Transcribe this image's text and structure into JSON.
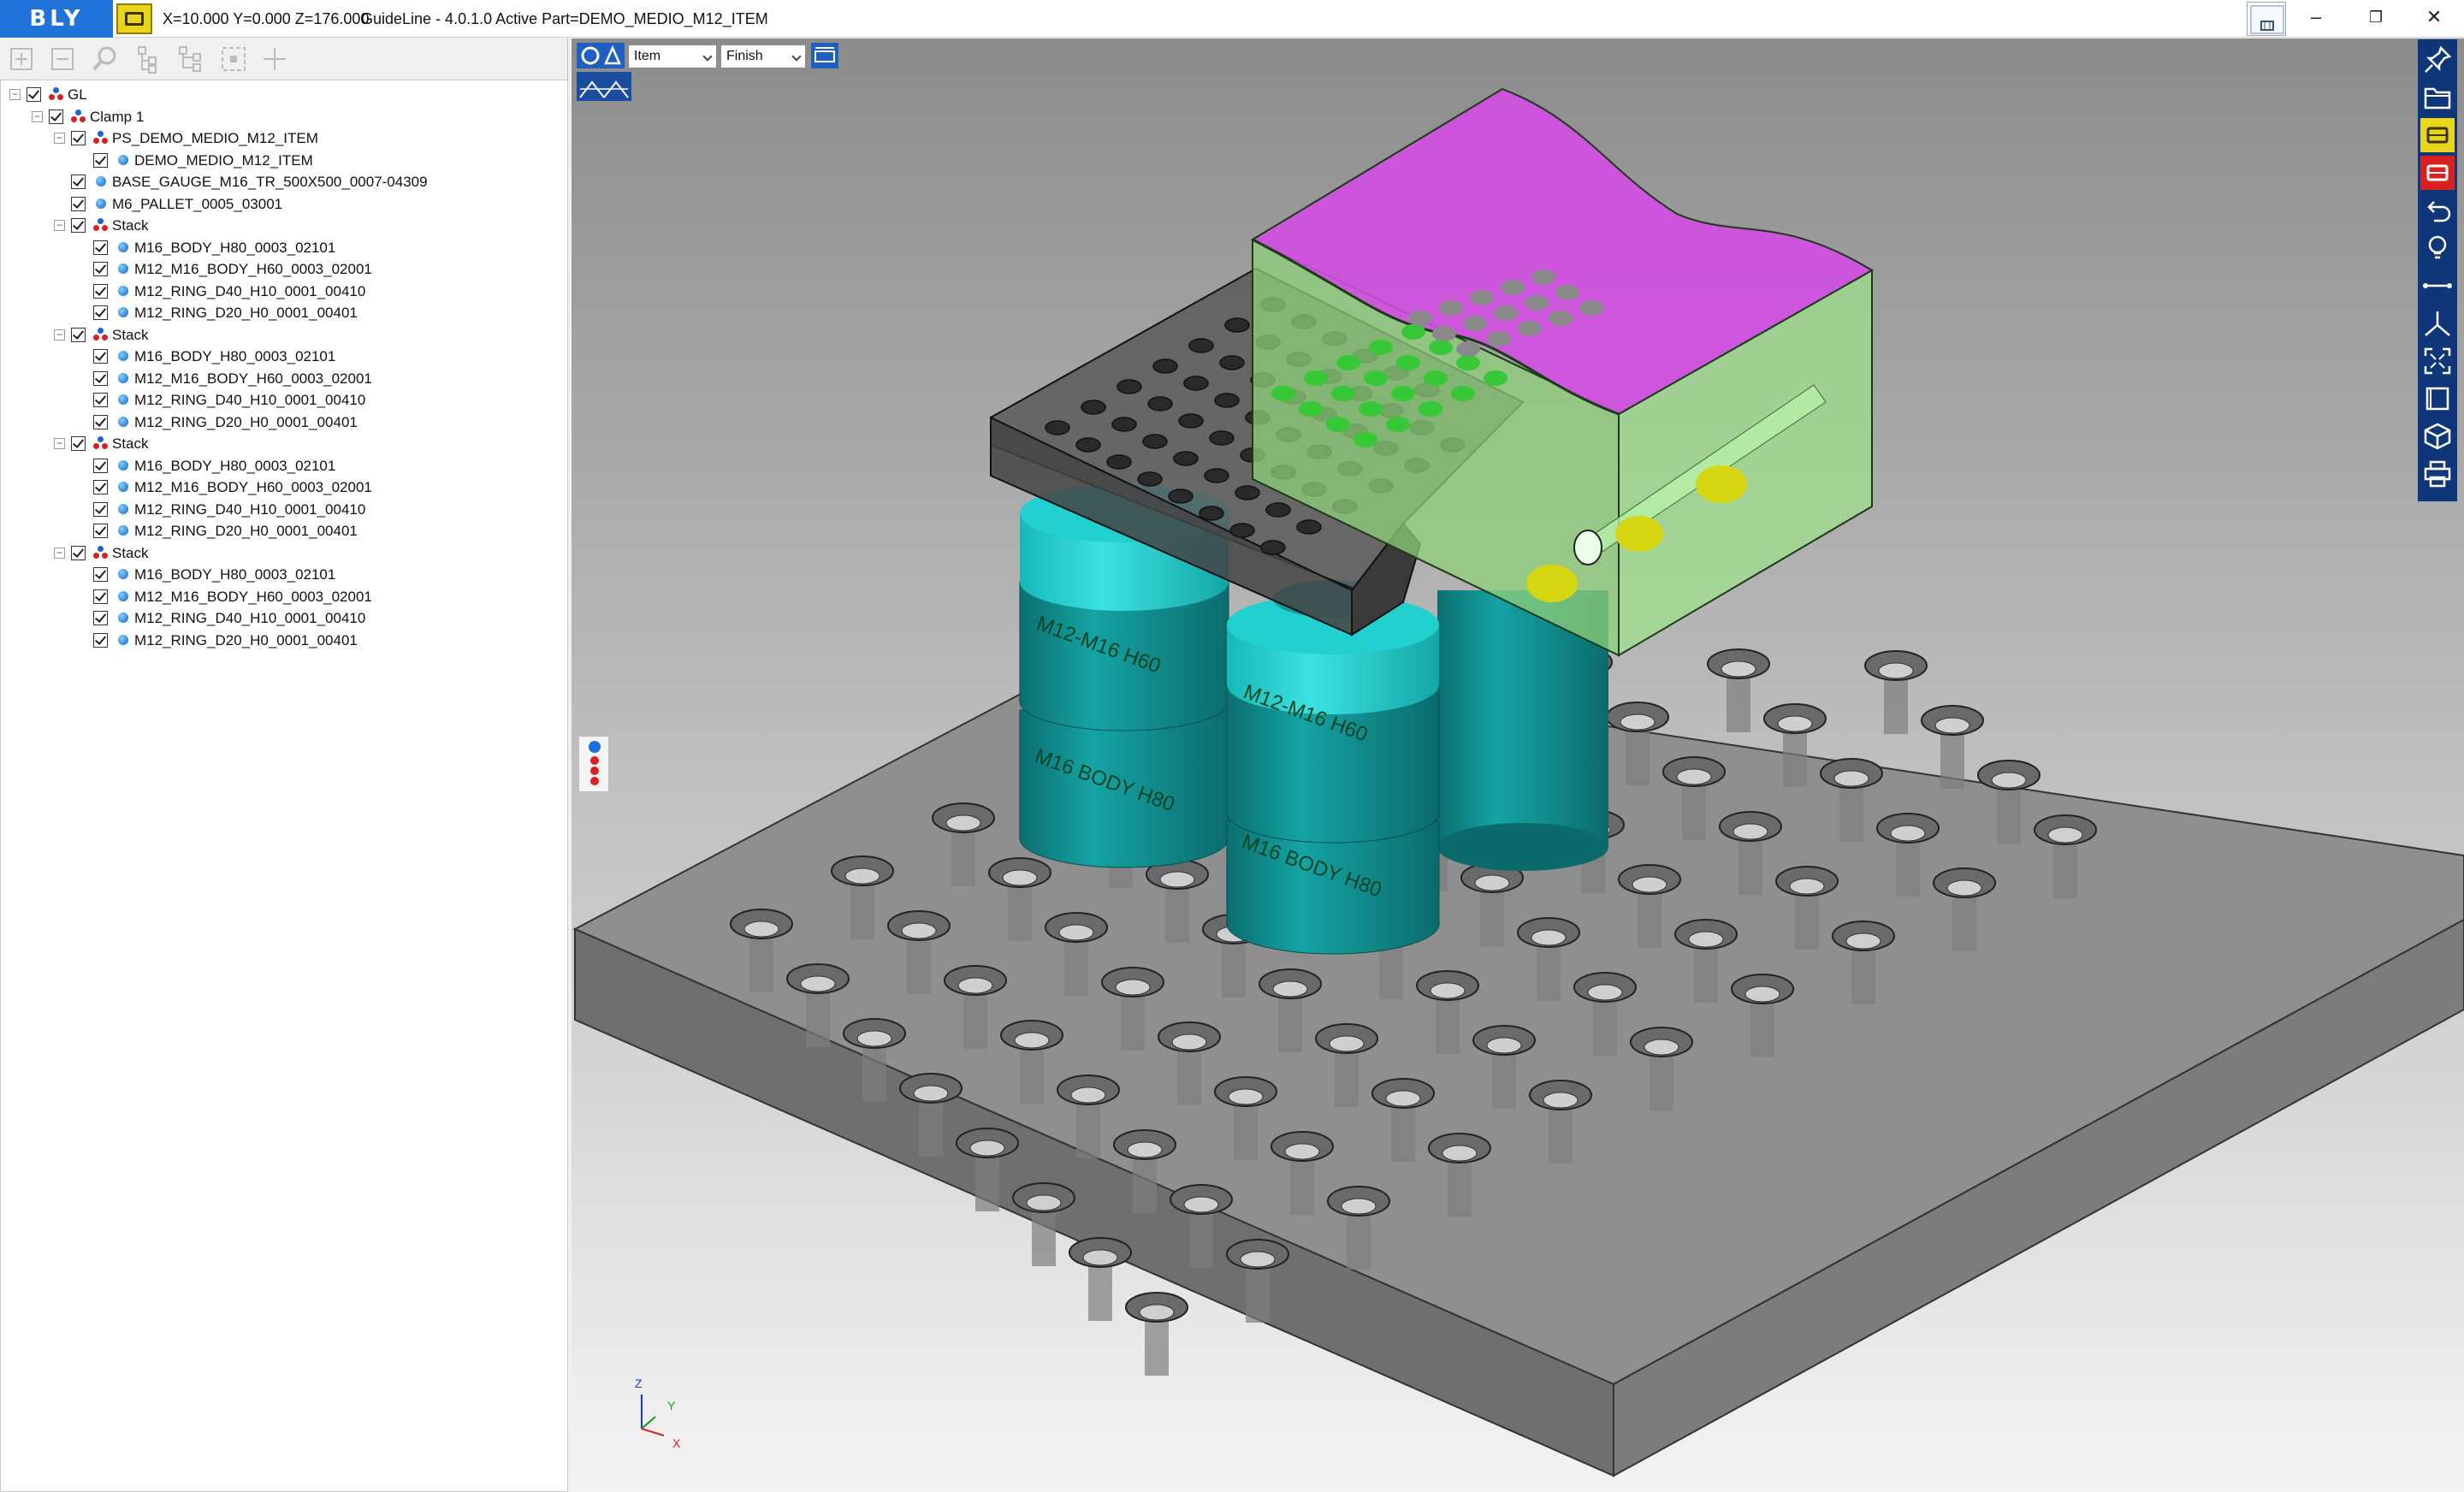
{
  "titlebar": {
    "logo": "BLY",
    "coordinates": "X=10.000 Y=0.000 Z=176.000",
    "title": "GuideLine - 4.0.1.0 Active Part=DEMO_MEDIO_M12_ITEM",
    "minimize": "–",
    "restore": "❐",
    "close": "✕"
  },
  "viewport_toolbar": {
    "mode_select": "Item",
    "finish_select": "Finish"
  },
  "tree": {
    "rows": [
      {
        "label": "GL",
        "level": 0,
        "type": "asm"
      },
      {
        "label": "Clamp 1",
        "level": 1,
        "type": "asm"
      },
      {
        "label": "PS_DEMO_MEDIO_M12_ITEM",
        "level": 2,
        "type": "asm"
      },
      {
        "label": "DEMO_MEDIO_M12_ITEM",
        "level": 3,
        "type": "part"
      },
      {
        "label": "BASE_GAUGE_M16_TR_500X500_0007-04309",
        "level": 2,
        "type": "part"
      },
      {
        "label": "M6_PALLET_0005_03001",
        "level": 2,
        "type": "part"
      },
      {
        "label": "Stack",
        "level": 2,
        "type": "asm"
      },
      {
        "label": "M16_BODY_H80_0003_02101",
        "level": 3,
        "type": "part"
      },
      {
        "label": "M12_M16_BODY_H60_0003_02001",
        "level": 3,
        "type": "part"
      },
      {
        "label": "M12_RING_D40_H10_0001_00410",
        "level": 3,
        "type": "part"
      },
      {
        "label": "M12_RING_D20_H0_0001_00401",
        "level": 3,
        "type": "part"
      },
      {
        "label": "Stack",
        "level": 2,
        "type": "asm"
      },
      {
        "label": "M16_BODY_H80_0003_02101",
        "level": 3,
        "type": "part"
      },
      {
        "label": "M12_M16_BODY_H60_0003_02001",
        "level": 3,
        "type": "part"
      },
      {
        "label": "M12_RING_D40_H10_0001_00410",
        "level": 3,
        "type": "part"
      },
      {
        "label": "M12_RING_D20_H0_0001_00401",
        "level": 3,
        "type": "part"
      },
      {
        "label": "Stack",
        "level": 2,
        "type": "asm"
      },
      {
        "label": "M16_BODY_H80_0003_02101",
        "level": 3,
        "type": "part"
      },
      {
        "label": "M12_M16_BODY_H60_0003_02001",
        "level": 3,
        "type": "part"
      },
      {
        "label": "M12_RING_D40_H10_0001_00410",
        "level": 3,
        "type": "part"
      },
      {
        "label": "M12_RING_D20_H0_0001_00401",
        "level": 3,
        "type": "part"
      },
      {
        "label": "Stack",
        "level": 2,
        "type": "asm"
      },
      {
        "label": "M16_BODY_H80_0003_02101",
        "level": 3,
        "type": "part"
      },
      {
        "label": "M12_M16_BODY_H60_0003_02001",
        "level": 3,
        "type": "part"
      },
      {
        "label": "M12_RING_D40_H10_0001_00410",
        "level": 3,
        "type": "part"
      },
      {
        "label": "M12_RING_D20_H0_0001_00401",
        "level": 3,
        "type": "part"
      }
    ]
  },
  "axis": {
    "z": "Z",
    "y": "Y",
    "x": "X"
  },
  "colors": {
    "accent": "#1f73d8",
    "toolbar_dark": "#10367a",
    "workpiece_top": "#d04ee0",
    "workpiece_side": "#8fd07a",
    "body": "#0f8a8a",
    "ring": "#18c8c8",
    "pallet": "#8a8a8a"
  }
}
